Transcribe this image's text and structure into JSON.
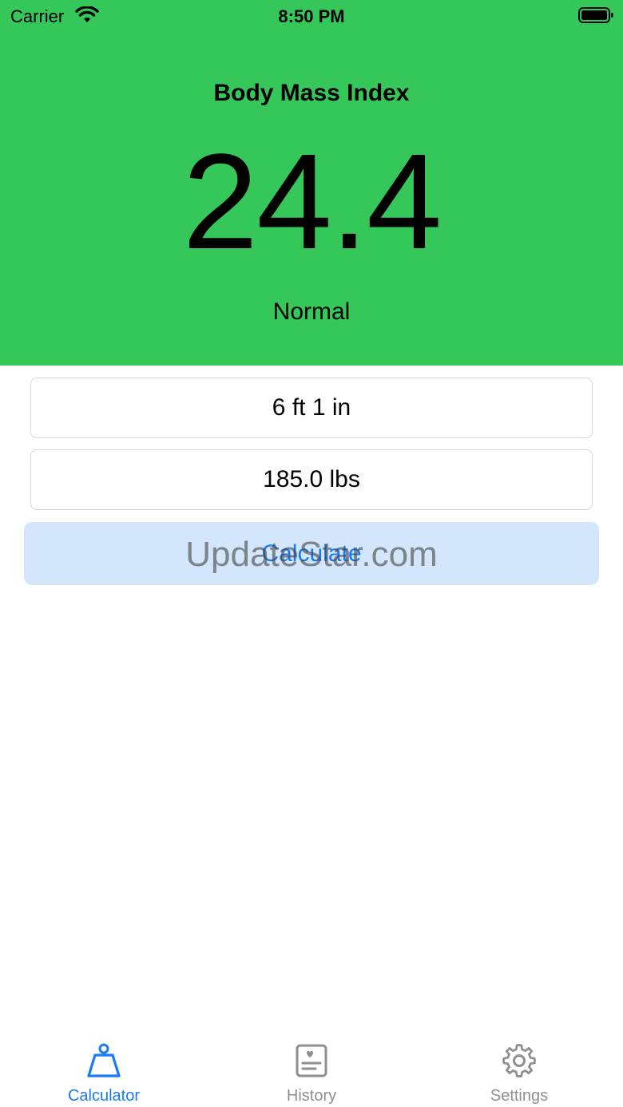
{
  "status_bar": {
    "carrier": "Carrier",
    "time": "8:50 PM"
  },
  "result": {
    "title": "Body Mass Index",
    "value": "24.4",
    "category": "Normal",
    "background_color": "#35c759"
  },
  "inputs": {
    "height": "6 ft 1 in",
    "weight": "185.0 lbs"
  },
  "calculate_button": {
    "label": "Calculate"
  },
  "watermark": "UpdateStar.com",
  "tabs": [
    {
      "label": "Calculator",
      "icon": "scale-weight-icon",
      "active": true
    },
    {
      "label": "History",
      "icon": "history-card-icon",
      "active": false
    },
    {
      "label": "Settings",
      "icon": "gear-icon",
      "active": false
    }
  ],
  "colors": {
    "accent": "#1a7af5",
    "inactive": "#8e8e93",
    "button_background": "#d3e6fc"
  }
}
